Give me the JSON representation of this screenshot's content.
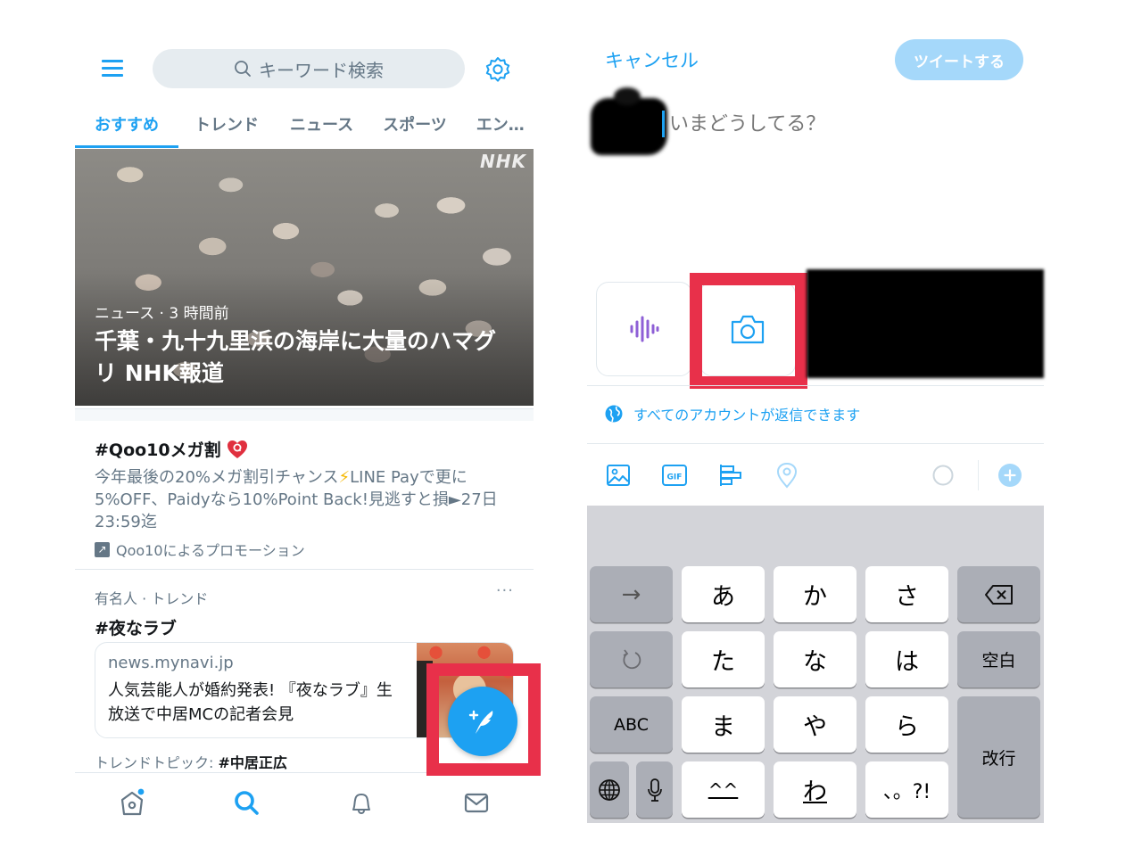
{
  "left_screen": {
    "header": {
      "menu_icon": "hamburger-icon",
      "search_placeholder": "キーワード検索",
      "settings_icon": "gear-icon"
    },
    "tabs": [
      {
        "label": "おすすめ",
        "active": true
      },
      {
        "label": "トレンド",
        "active": false
      },
      {
        "label": "ニュース",
        "active": false
      },
      {
        "label": "スポーツ",
        "active": false
      },
      {
        "label": "エン…",
        "active": false
      }
    ],
    "hero": {
      "watermark": "NHK",
      "meta": "ニュース · 3 時間前",
      "title": "千葉・九十九里浜の海岸に大量のハマグリ NHK報道"
    },
    "promoted": {
      "hashtag": "#Qoo10メガ割",
      "body_before_bolt": "今年最後の20%メガ割引チャンス",
      "bolt": "⚡",
      "body_after_bolt": "LINE Payで更に5%OFF、Paidyなら10%Point Back!見逃すと損►27日23:59迄",
      "promoted_by": "Qoo10によるプロモーション"
    },
    "trend": {
      "meta": "有名人 · トレンド",
      "more": "···",
      "hashtag": "#夜なラブ",
      "card": {
        "domain": "news.mynavi.jp",
        "title": "人気芸能人が婚約発表! 『夜なラブ』生放送で中居MCの記者会見"
      },
      "topic_label": "トレンドトピック:",
      "topic_value": "#中居正広"
    },
    "fab": {
      "icon": "compose-tweet-icon",
      "highlighted": true
    },
    "bottom_nav": [
      {
        "name": "home",
        "icon": "home-icon",
        "badge": true
      },
      {
        "name": "search",
        "icon": "search-icon",
        "active": true
      },
      {
        "name": "notifications",
        "icon": "bell-icon"
      },
      {
        "name": "messages",
        "icon": "mail-icon"
      }
    ]
  },
  "right_screen": {
    "header": {
      "cancel_label": "キャンセル",
      "tweet_label": "ツイートする"
    },
    "compose": {
      "placeholder": "いまどうしてる？",
      "value": ""
    },
    "media_tiles": [
      {
        "icon": "voice-waveform-icon"
      },
      {
        "icon": "camera-icon",
        "highlighted": true
      }
    ],
    "reply_setting": "すべてのアカウントが返信できます",
    "toolbar": [
      {
        "icon": "image-icon"
      },
      {
        "icon": "gif-icon",
        "label": "GIF"
      },
      {
        "icon": "poll-icon"
      },
      {
        "icon": "location-icon"
      },
      {
        "icon": "character-counter-icon"
      },
      {
        "icon": "add-thread-icon"
      }
    ],
    "keyboard": {
      "rows": [
        [
          "→",
          "あ",
          "か",
          "さ",
          "⌫"
        ],
        [
          "↺",
          "た",
          "な",
          "は",
          "空白"
        ],
        [
          "ABC",
          "ま",
          "や",
          "ら",
          "改行"
        ],
        [
          "🌐",
          "🎤",
          "^^",
          "わ",
          "、。?!"
        ]
      ],
      "keys": {
        "next": "→",
        "a": "あ",
        "ka": "か",
        "sa": "さ",
        "undo": "↺",
        "ta": "た",
        "na": "な",
        "ha": "は",
        "space": "空白",
        "abc": "ABC",
        "ma": "ま",
        "ya": "や",
        "ra": "ら",
        "enter": "改行",
        "kaomoji": "^^",
        "wa": "わ",
        "punct": "、。?!"
      }
    }
  },
  "colors": {
    "accent": "#1da1f2",
    "highlight_box": "#e8304a",
    "secondary_text": "#657786",
    "keyboard_bg": "#d3d4d9"
  }
}
